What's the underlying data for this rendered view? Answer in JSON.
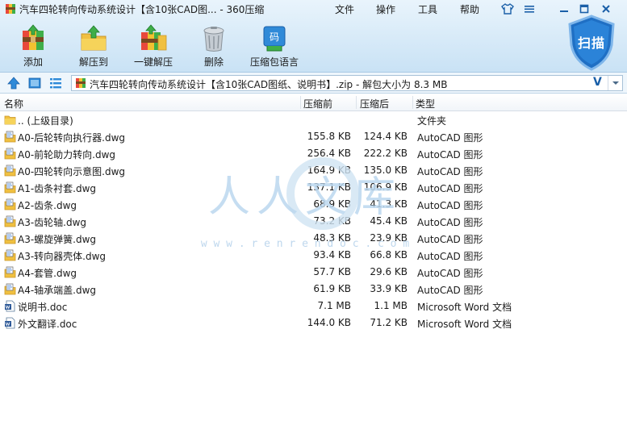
{
  "window": {
    "title": "汽车四轮转向传动系统设计【含10张CAD图... - 360压缩",
    "menu": [
      "文件",
      "操作",
      "工具",
      "帮助"
    ]
  },
  "toolbar": {
    "add_label": "添加",
    "extract_label": "解压到",
    "one_click_label": "一键解压",
    "delete_label": "删除",
    "password_label": "压缩包语言",
    "scan_label": "扫描",
    "password_badge": "码"
  },
  "address": {
    "path": "汽车四轮转向传动系统设计【含10张CAD图纸、说明书】.zip - 解包大小为 8.3 MB",
    "v_label": "V"
  },
  "columns": {
    "name": "名称",
    "size": "压缩前",
    "packed": "压缩后",
    "type": "类型"
  },
  "files": [
    {
      "name": ".. (上级目录)",
      "size": "",
      "packed": "",
      "type": "文件夹",
      "icon": "folder-icon"
    },
    {
      "name": "A0-后轮转向执行器.dwg",
      "size": "155.8 KB",
      "packed": "124.4 KB",
      "type": "AutoCAD 图形",
      "icon": "dwg-icon"
    },
    {
      "name": "A0-前轮助力转向.dwg",
      "size": "256.4 KB",
      "packed": "222.2 KB",
      "type": "AutoCAD 图形",
      "icon": "dwg-icon"
    },
    {
      "name": "A0-四轮转向示意图.dwg",
      "size": "164.9 KB",
      "packed": "135.0 KB",
      "type": "AutoCAD 图形",
      "icon": "dwg-icon"
    },
    {
      "name": "A1-齿条衬套.dwg",
      "size": "137.1 KB",
      "packed": "106.9 KB",
      "type": "AutoCAD 图形",
      "icon": "dwg-icon"
    },
    {
      "name": "A2-齿条.dwg",
      "size": "68.9 KB",
      "packed": "41.3 KB",
      "type": "AutoCAD 图形",
      "icon": "dwg-icon"
    },
    {
      "name": "A3-齿轮轴.dwg",
      "size": "73.2 KB",
      "packed": "45.4 KB",
      "type": "AutoCAD 图形",
      "icon": "dwg-icon"
    },
    {
      "name": "A3-螺旋弹簧.dwg",
      "size": "48.3 KB",
      "packed": "23.9 KB",
      "type": "AutoCAD 图形",
      "icon": "dwg-icon"
    },
    {
      "name": "A3-转向器壳体.dwg",
      "size": "93.4 KB",
      "packed": "66.8 KB",
      "type": "AutoCAD 图形",
      "icon": "dwg-icon"
    },
    {
      "name": "A4-套管.dwg",
      "size": "57.7 KB",
      "packed": "29.6 KB",
      "type": "AutoCAD 图形",
      "icon": "dwg-icon"
    },
    {
      "name": "A4-轴承端盖.dwg",
      "size": "61.9 KB",
      "packed": "33.9 KB",
      "type": "AutoCAD 图形",
      "icon": "dwg-icon"
    },
    {
      "name": "说明书.doc",
      "size": "7.1 MB",
      "packed": "1.1 MB",
      "type": "Microsoft Word 文档",
      "icon": "word-doc-icon"
    },
    {
      "name": "外文翻译.doc",
      "size": "144.0 KB",
      "packed": "71.2 KB",
      "type": "Microsoft Word 文档",
      "icon": "word-doc-icon"
    }
  ],
  "watermark": {
    "text": "人人文库",
    "url": "w w w . r e n r e n d o c . c o m"
  },
  "colors": {
    "accent": "#1a6fc4",
    "header_bg": "#d7eaf8",
    "folder": "#f0c040"
  }
}
